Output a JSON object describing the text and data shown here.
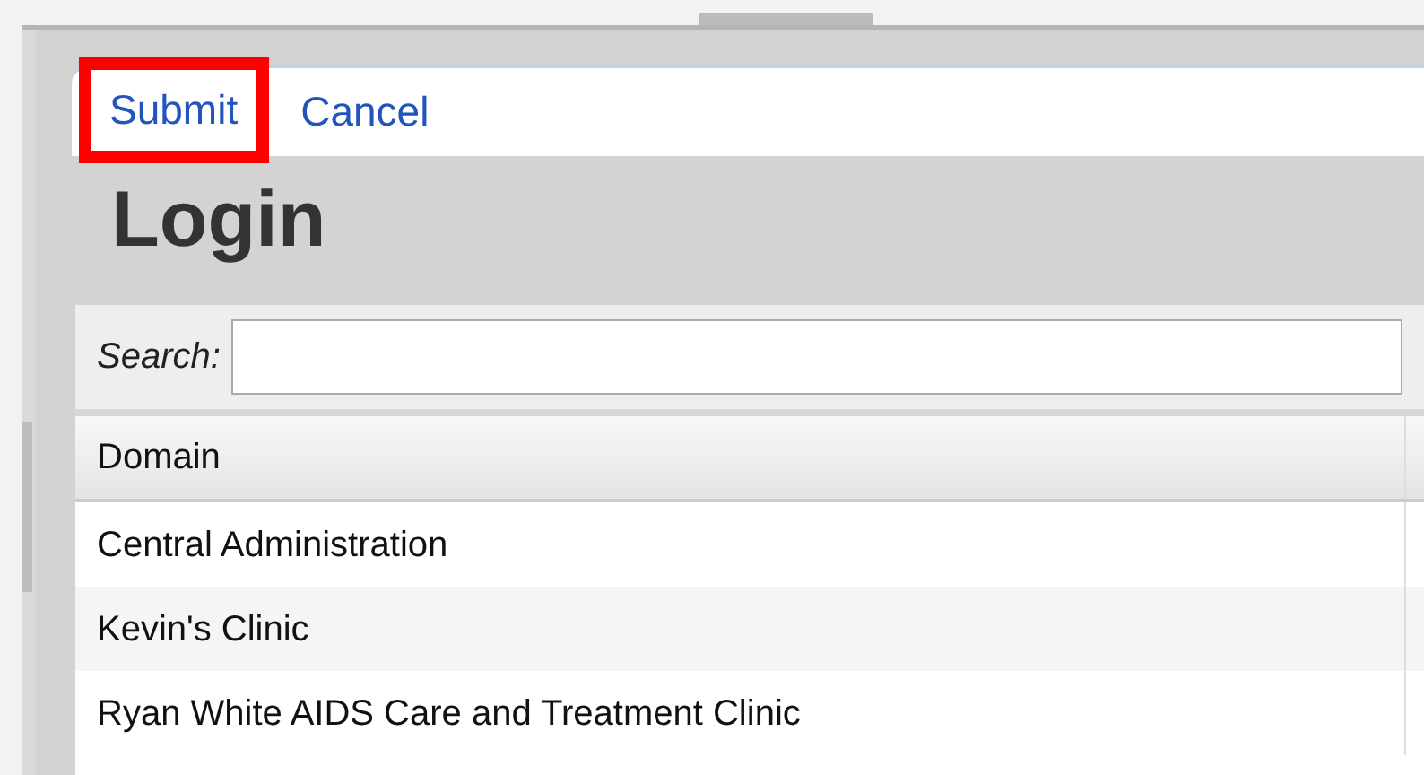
{
  "toolbar": {
    "buttons": [
      {
        "label": "Submit",
        "highlighted": true
      },
      {
        "label": "Cancel",
        "highlighted": false
      }
    ]
  },
  "title": "Login",
  "search": {
    "label": "Search:"
  },
  "table": {
    "columns": [
      "Domain"
    ],
    "rows": [
      [
        "Central Administration"
      ],
      [
        "Kevin's Clinic"
      ],
      [
        "Ryan White AIDS Care and Treatment Clinic"
      ]
    ]
  }
}
